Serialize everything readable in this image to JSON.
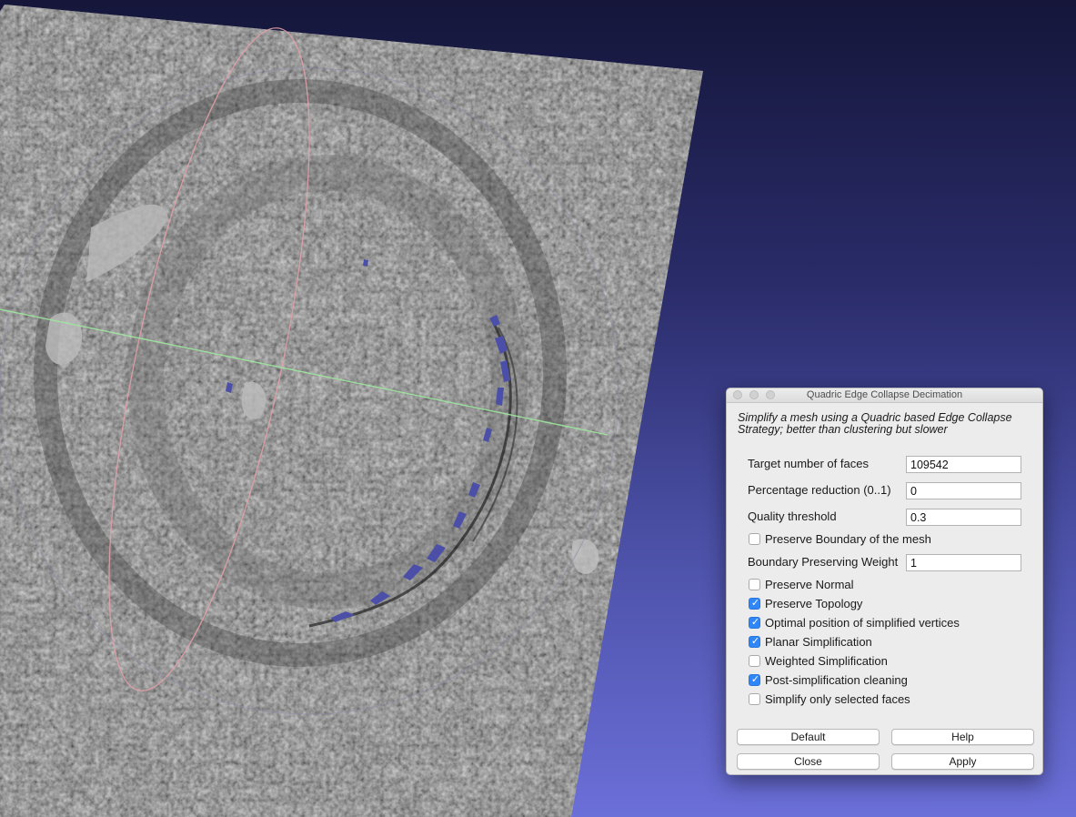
{
  "window": {
    "title": "Quadric Edge Collapse Decimation",
    "description": "Simplify a mesh using a Quadric based Edge Collapse Strategy; better than clustering but slower"
  },
  "params": {
    "target_faces": {
      "label": "Target number of faces",
      "value": "109542"
    },
    "percentage_reduction": {
      "label": "Percentage reduction (0..1)",
      "value": "0"
    },
    "quality_threshold": {
      "label": "Quality threshold",
      "value": "0.3"
    },
    "preserve_boundary": {
      "label": "Preserve Boundary of the mesh",
      "checked": false
    },
    "boundary_weight": {
      "label": "Boundary Preserving Weight",
      "value": "1"
    },
    "preserve_normal": {
      "label": "Preserve Normal",
      "checked": false
    },
    "preserve_topology": {
      "label": "Preserve Topology",
      "checked": true
    },
    "optimal_position": {
      "label": "Optimal position of simplified vertices",
      "checked": true
    },
    "planar_simplification": {
      "label": "Planar Simplification",
      "checked": true
    },
    "weighted_simplification": {
      "label": "Weighted Simplification",
      "checked": false
    },
    "post_cleaning": {
      "label": "Post-simplification cleaning",
      "checked": true
    },
    "selected_only": {
      "label": "Simplify only selected faces",
      "checked": false
    }
  },
  "buttons": {
    "default": "Default",
    "help": "Help",
    "close": "Close",
    "apply": "Apply"
  },
  "colors": {
    "background_top": "#15163a",
    "background_bottom": "#6b6fd8",
    "mesh_gray": "#a8a8a8",
    "selection_blue": "#4b4fa8",
    "checkbox_blue": "#2f86f6",
    "x_axis_green": "#9ee89e",
    "y_axis_pink": "#e2a0a8"
  }
}
